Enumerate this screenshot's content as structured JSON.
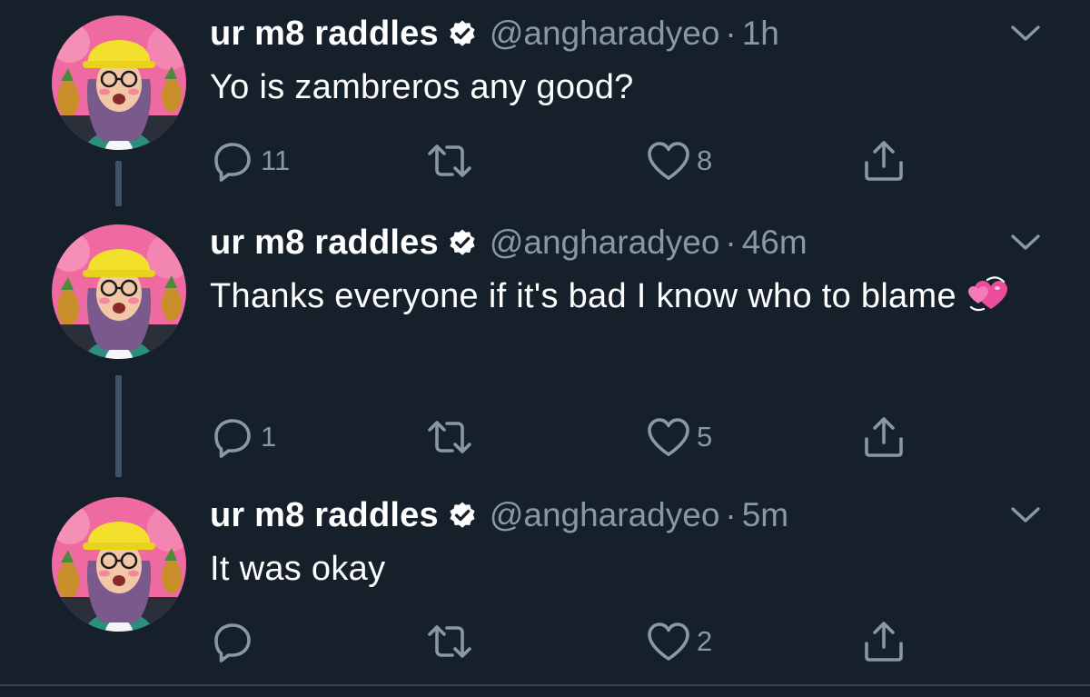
{
  "colors": {
    "background": "#15202b",
    "secondary_text": "#8899a6",
    "thread_line": "#3d5466",
    "verified": "#ffffff"
  },
  "tweets": [
    {
      "name": "ur m8 raddles",
      "handle": "@angharadyeo",
      "separator": "·",
      "time": "1h",
      "text": "Yo is zambreros any good?",
      "emoji": "",
      "reply_count": "11",
      "retweet_count": "",
      "like_count": "8"
    },
    {
      "name": "ur m8 raddles",
      "handle": "@angharadyeo",
      "separator": "·",
      "time": "46m",
      "text": "Thanks everyone if it's bad I know who to blame",
      "emoji": "revolving-hearts-emoji",
      "reply_count": "1",
      "retweet_count": "",
      "like_count": "5"
    },
    {
      "name": "ur m8 raddles",
      "handle": "@angharadyeo",
      "separator": "·",
      "time": "5m",
      "text": "It was okay",
      "emoji": "",
      "reply_count": "",
      "retweet_count": "",
      "like_count": "2"
    }
  ],
  "icons": {
    "reply": "reply-icon",
    "retweet": "retweet-icon",
    "like": "heart-icon",
    "share": "share-icon",
    "more": "chevron-down-icon",
    "verified": "verified-badge-icon"
  }
}
